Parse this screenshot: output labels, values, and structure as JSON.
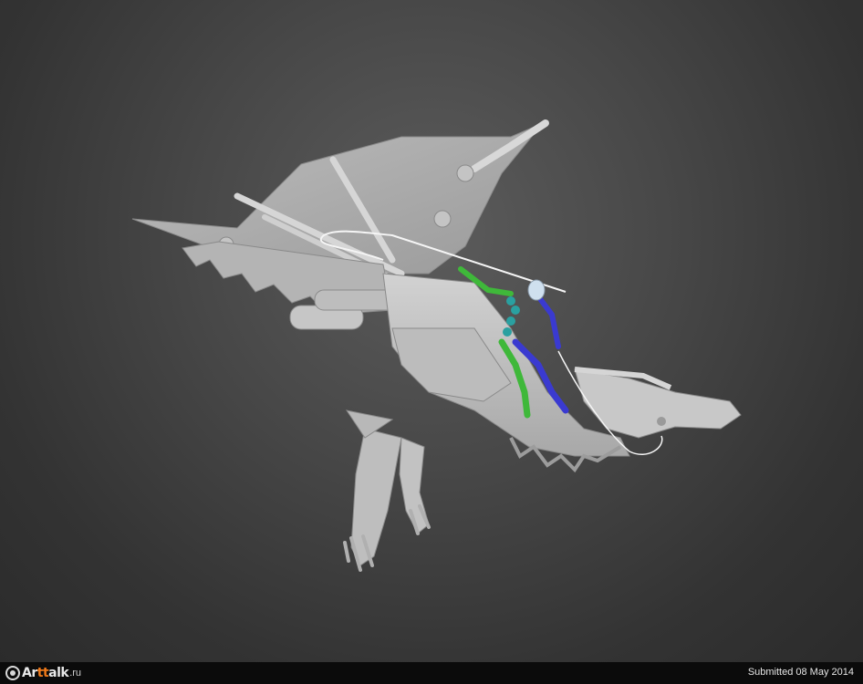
{
  "scene": {
    "subject": "dragon-rider-3d-render",
    "colors": {
      "background_center": "#5c5c5c",
      "background_edge": "#2b2b2b",
      "model_gray": "#c9c9c9",
      "rig_green": "#3fb83a",
      "rig_blue": "#3a3ad0",
      "rig_teal": "#2aa0a0"
    }
  },
  "footer": {
    "logo_prefix": "Ar",
    "logo_highlight": "tt",
    "logo_rest": "alk",
    "logo_suffix": ".ru",
    "submitted_text": "Submitted 08 May 2014"
  }
}
